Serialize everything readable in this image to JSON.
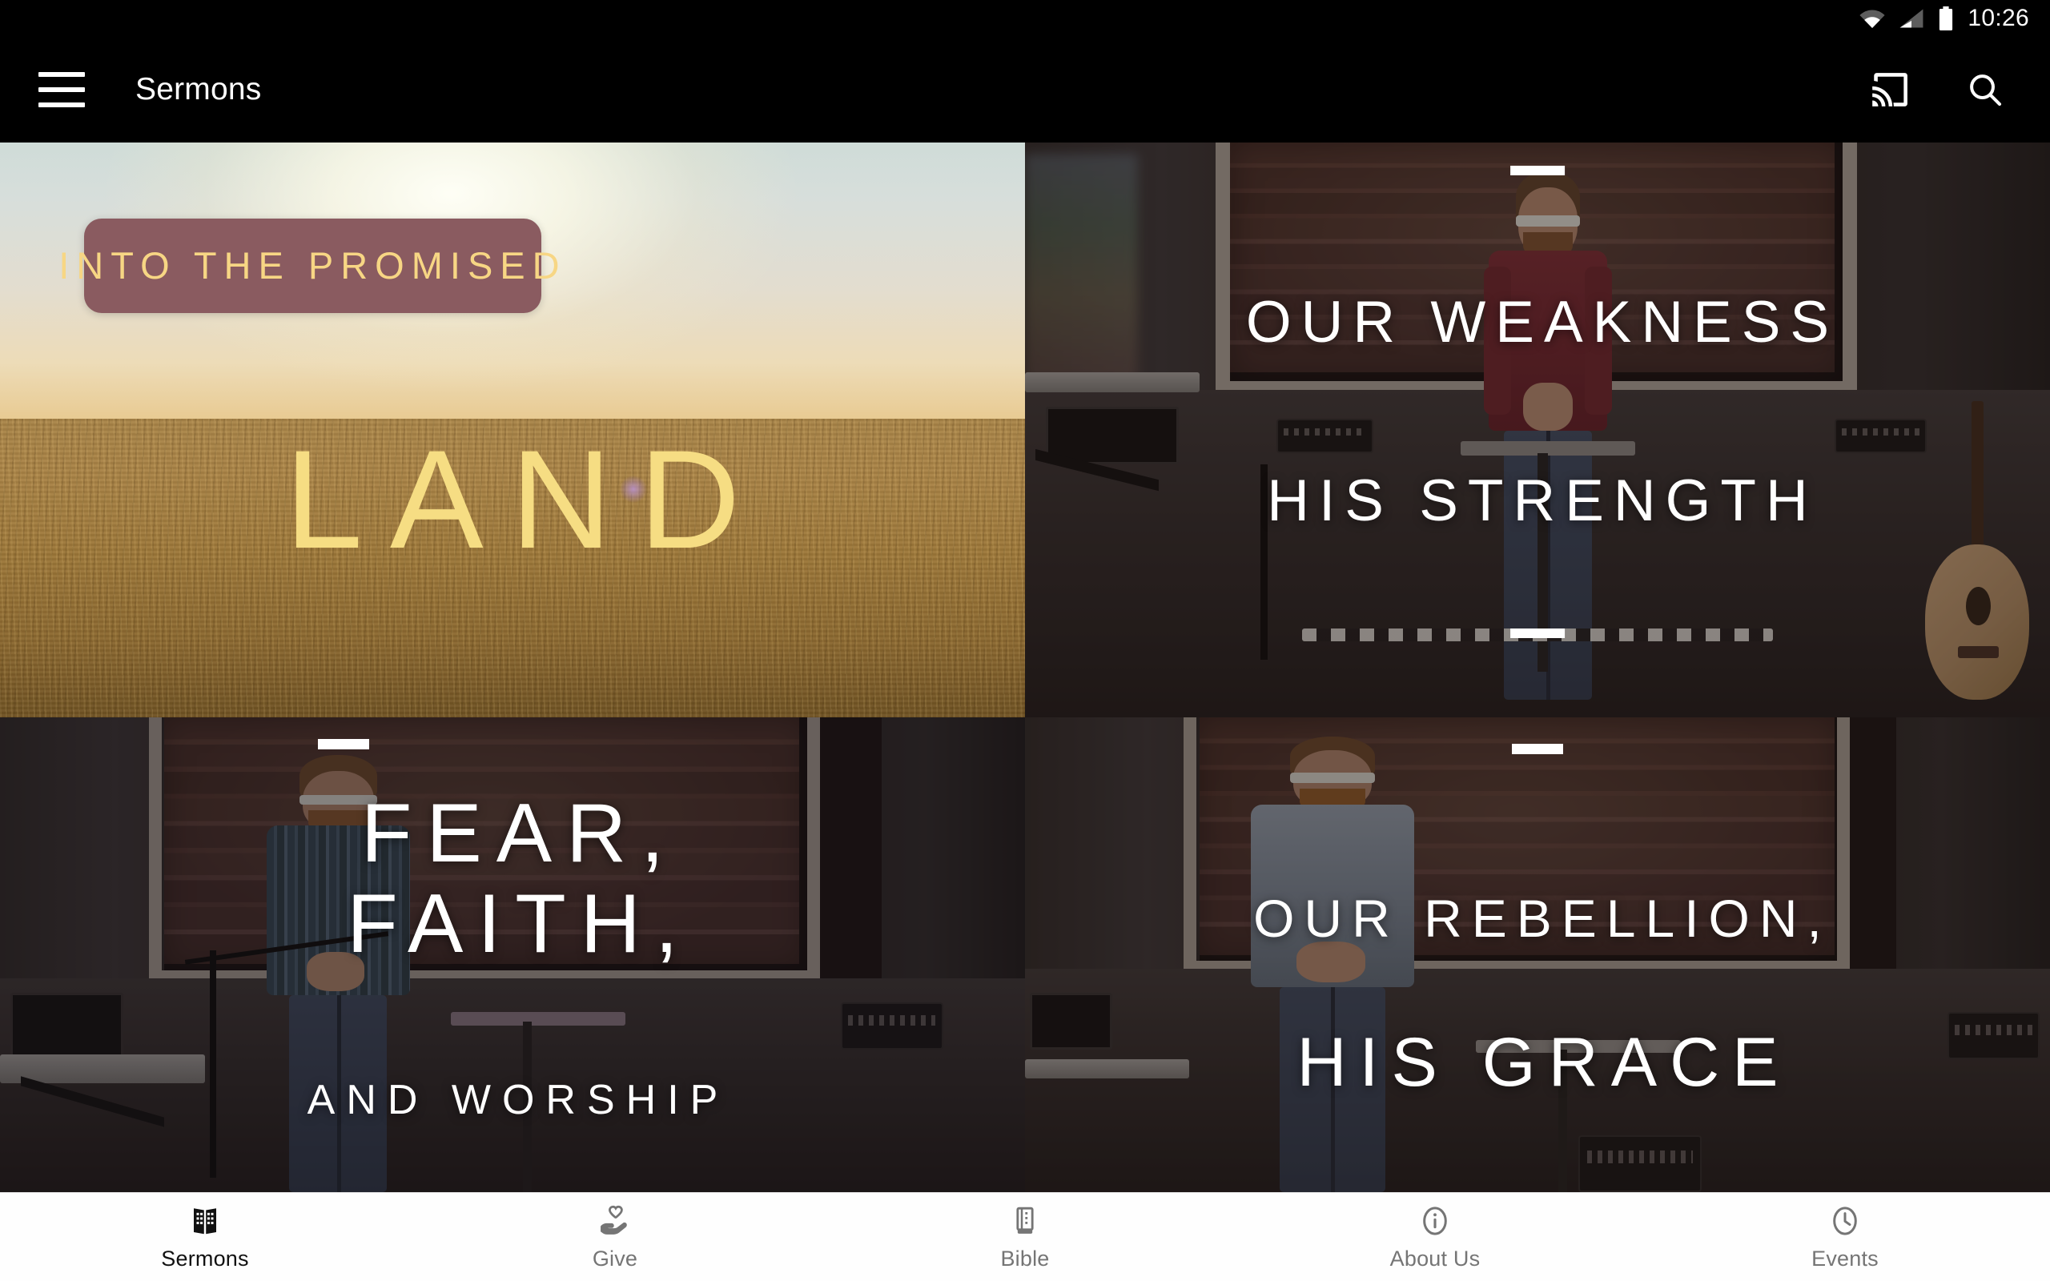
{
  "status_bar": {
    "time": "10:26",
    "icons": [
      "wifi-icon",
      "cellular-signal-icon",
      "battery-icon"
    ]
  },
  "app_bar": {
    "menu_icon": "hamburger-menu-icon",
    "title": "Sermons",
    "actions": [
      {
        "name": "cast-icon",
        "label": "Cast"
      },
      {
        "name": "search-icon",
        "label": "Search"
      }
    ]
  },
  "sermons": [
    {
      "id": "into-the-promised-land",
      "banner_text": "INTO THE PROMISED",
      "title": "LAND",
      "style": "wheat-field-sunset",
      "colors": {
        "banner_bg": "#8a5b60",
        "banner_text": "#f7d684",
        "title_text": "#f6dd83"
      }
    },
    {
      "id": "our-weakness-his-strength",
      "line1": "OUR WEAKNESS",
      "line2": "HIS STRENGTH",
      "style": "stage-maroon-shirt",
      "colors": {
        "text": "#ffffff",
        "shirt": "#7e3038"
      }
    },
    {
      "id": "fear-faith-and-worship",
      "line1": "FEAR,",
      "line2": "FAITH,",
      "line3": "AND WORSHIP",
      "style": "stage-plaid-shirt",
      "colors": {
        "text": "#ffffff",
        "shirt": "#46555f"
      }
    },
    {
      "id": "our-rebellion-his-grace",
      "line1": "OUR REBELLION,",
      "line2": "HIS GRACE",
      "style": "stage-light-blue-shirt",
      "colors": {
        "text": "#ffffff",
        "shirt": "#9aa6b4"
      }
    }
  ],
  "bottom_nav": {
    "active": "Sermons",
    "items": [
      {
        "label": "Sermons",
        "icon": "open-book-icon"
      },
      {
        "label": "Give",
        "icon": "hand-holding-heart-icon"
      },
      {
        "label": "Bible",
        "icon": "bible-book-icon"
      },
      {
        "label": "About Us",
        "icon": "info-circle-icon"
      },
      {
        "label": "Events",
        "icon": "clock-icon"
      }
    ]
  },
  "theme": {
    "app_bar_bg": "#000000",
    "nav_bg": "#fefefe",
    "nav_inactive": "#757575",
    "nav_active": "#111111"
  }
}
